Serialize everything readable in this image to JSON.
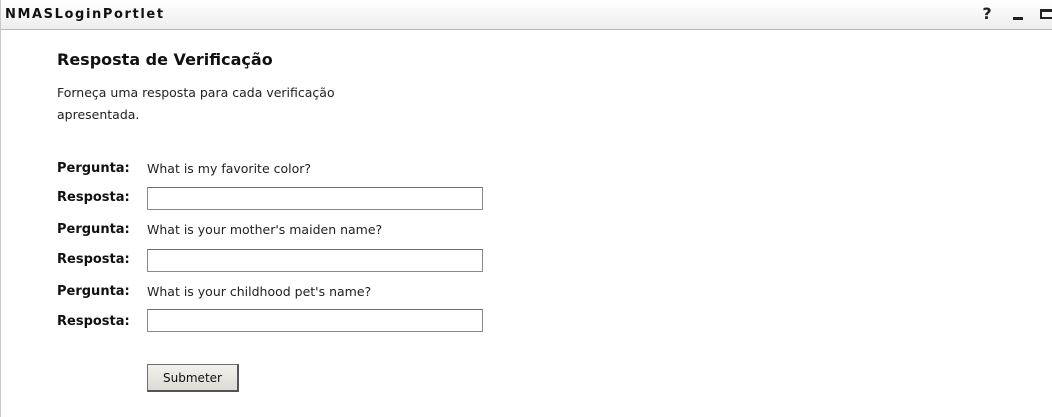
{
  "titlebar": {
    "title": "NMASLoginPortlet",
    "help_label": "?",
    "help_icon": "help-icon",
    "minimize_icon": "minimize-icon",
    "maximize_icon": "maximize-icon"
  },
  "form": {
    "heading": "Resposta de Verificação",
    "intro": "Forneça uma resposta para cada verificação apresentada.",
    "question_label": "Pergunta:",
    "answer_label": "Resposta:",
    "items": [
      {
        "question": "What is my favorite color?",
        "answer": ""
      },
      {
        "question": "What is your mother's maiden name?",
        "answer": ""
      },
      {
        "question": "What is your childhood pet's name?",
        "answer": ""
      }
    ],
    "submit_label": "Submeter"
  }
}
